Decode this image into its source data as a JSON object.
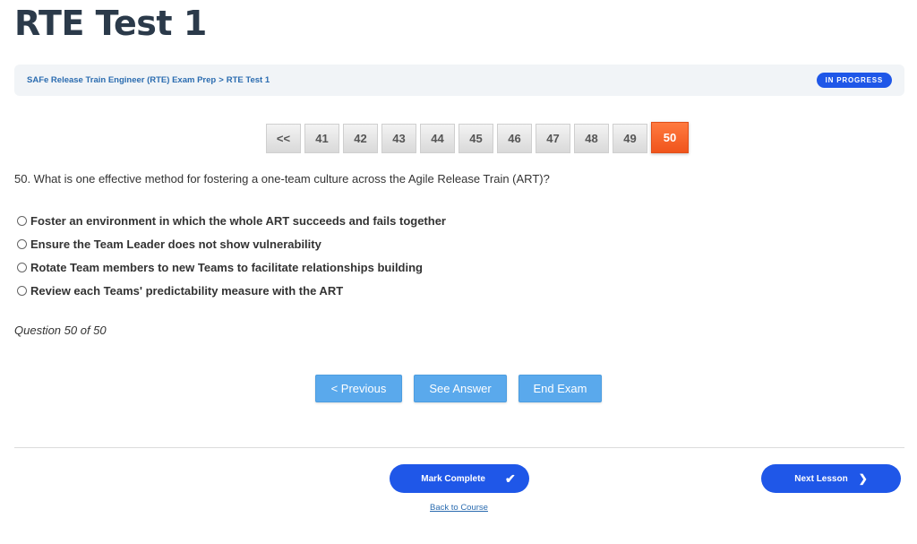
{
  "page": {
    "title": "RTE Test 1"
  },
  "breadcrumb": {
    "course": "SAFe Release Train Engineer (RTE) Exam Prep",
    "separator": ">",
    "current": "RTE Test 1"
  },
  "status": {
    "label": "IN PROGRESS"
  },
  "pager": {
    "prev_label": "<<",
    "pages": [
      "41",
      "42",
      "43",
      "44",
      "45",
      "46",
      "47",
      "48",
      "49"
    ],
    "active": "50"
  },
  "question": {
    "text": "50. What is one effective method for fostering a one-team culture across the Agile Release Train (ART)?",
    "options": [
      "Foster an environment in which the whole ART succeeds and fails together",
      "Ensure the Team Leader does not show vulnerability",
      "Rotate Team members to new Teams to facilitate relationships building",
      "Review each Teams' predictability measure with the ART"
    ],
    "count_label": "Question 50 of 50"
  },
  "exam_buttons": {
    "previous": "< Previous",
    "see_answer": "See Answer",
    "end_exam": "End Exam"
  },
  "footer": {
    "mark_complete": "Mark Complete",
    "next_lesson": "Next Lesson",
    "back_to_course": "Back to Course"
  },
  "colors": {
    "primary": "#1f57e8",
    "active_page": "#f0541c",
    "exam_button": "#5aa9ec"
  }
}
